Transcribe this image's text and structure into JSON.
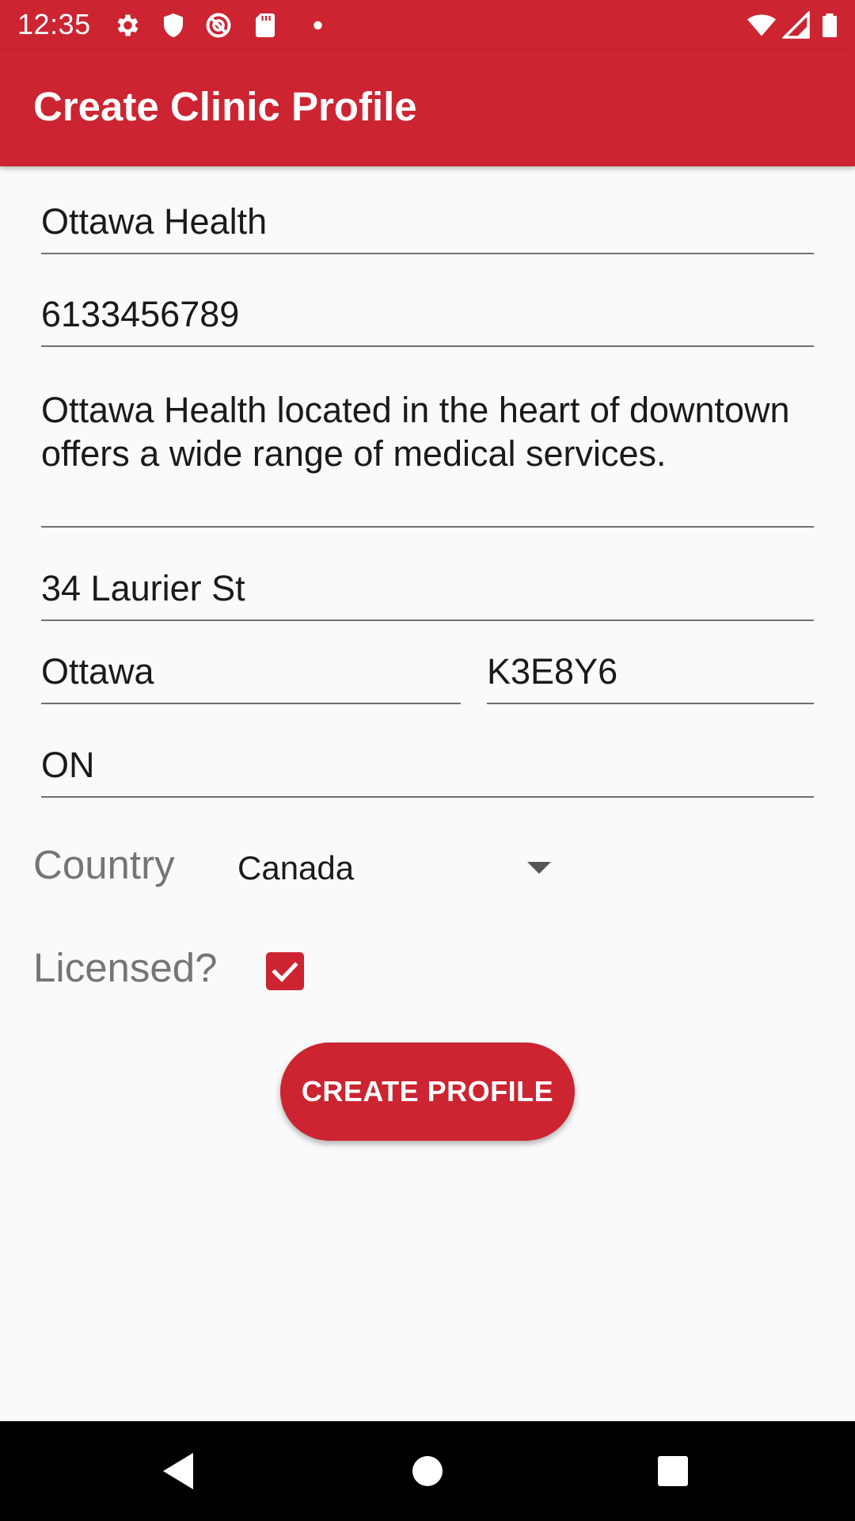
{
  "status_bar": {
    "time": "12:35",
    "icons_left": [
      "gear-icon",
      "shield-icon",
      "no-sync-icon",
      "sd-card-icon",
      "dot-icon"
    ],
    "icons_right": [
      "wifi-icon",
      "signal-icon",
      "battery-icon"
    ]
  },
  "app_bar": {
    "title": "Create Clinic Profile",
    "color": "#cc2431"
  },
  "form": {
    "clinic_name": "Ottawa Health",
    "phone": "6133456789",
    "description": "Ottawa Health located in the heart of downtown offers a wide range of medical services.",
    "street": "34 Laurier St",
    "city": "Ottawa",
    "postal_code": "K3E8Y6",
    "province": "ON",
    "country_label": "Country",
    "country_value": "Canada",
    "licensed_label": "Licensed?",
    "licensed_checked": true,
    "create_button_label": "CREATE PROFILE"
  },
  "nav_bar": {
    "icons": [
      "back-icon",
      "home-icon",
      "recents-icon"
    ]
  }
}
